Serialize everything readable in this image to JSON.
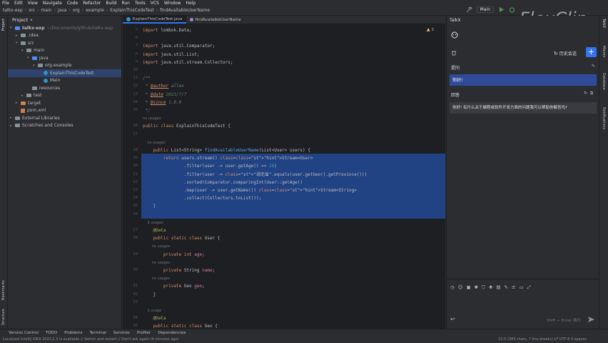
{
  "menu": [
    "File",
    "Edit",
    "View",
    "Navigate",
    "Code",
    "Refactor",
    "Build",
    "Run",
    "Tools",
    "VCS",
    "Window",
    "Help"
  ],
  "breadcrumbs": [
    "talkx-exp",
    "src",
    "main",
    "java",
    "org",
    "example",
    "ExplainThisCodeTest",
    "findAvailableUserName"
  ],
  "run_config": "Main",
  "watermark": "FlexClip",
  "project_panel": {
    "title": "Project",
    "tree": [
      {
        "label": "talkx-exp",
        "extra": "~/Documents/github/talkx-exp",
        "type": "folder-blue",
        "depth": 0,
        "arrow": "▾"
      },
      {
        "label": ".idea",
        "type": "folder",
        "depth": 1,
        "arrow": "▸"
      },
      {
        "label": "src",
        "type": "folder",
        "depth": 1,
        "arrow": "▾"
      },
      {
        "label": "main",
        "type": "folder",
        "depth": 2,
        "arrow": "▾"
      },
      {
        "label": "java",
        "type": "folder-blue",
        "depth": 3,
        "arrow": "▾"
      },
      {
        "label": "org.example",
        "type": "folder",
        "depth": 4,
        "arrow": "▾"
      },
      {
        "label": "ExplainThisCodeTest",
        "type": "java",
        "depth": 5,
        "arrow": "",
        "selected": true
      },
      {
        "label": "Main",
        "type": "java",
        "depth": 5,
        "arrow": ""
      },
      {
        "label": "resources",
        "type": "folder",
        "depth": 3,
        "arrow": ""
      },
      {
        "label": "test",
        "type": "folder",
        "depth": 2,
        "arrow": "▸"
      },
      {
        "label": "target",
        "type": "folder-orange",
        "depth": 1,
        "arrow": "▸"
      },
      {
        "label": "pom.xml",
        "type": "xml",
        "depth": 1,
        "arrow": ""
      },
      {
        "label": "External Libraries",
        "type": "folder",
        "depth": 0,
        "arrow": "▸"
      },
      {
        "label": "Scratches and Consoles",
        "type": "folder",
        "depth": 0,
        "arrow": "▸"
      }
    ]
  },
  "editor": {
    "tabs": [
      "ExplainThisCodeTest.java",
      "findAvailableUserName"
    ],
    "warning_count": "3",
    "line_numbers": [
      "5",
      "6",
      "7",
      "8",
      "9",
      "10",
      "11",
      "12",
      "13",
      "14",
      "15",
      "16",
      "17",
      "18",
      "19",
      "20",
      "21",
      "22",
      "23",
      "24",
      "25",
      "26",
      "27",
      "28",
      "29",
      "30",
      "31",
      "32",
      "33",
      "34",
      "35",
      "36",
      "37"
    ],
    "code": [
      "import lombok.Data;",
      "",
      "import java.util.Comparator;",
      "import java.util.List;",
      "import java.util.stream.Collectors;",
      "",
      "/**",
      " * @author allen",
      " * @date 2023/7/7",
      " * @since 1.0.0",
      " */",
      "no usages",
      "public class ExplainThisCodeTest {",
      "",
      "    no usages",
      "    public List<String> findAvailableUserName(List<User> users) {",
      "        return users.stream() Stream<User>",
      "                .filter(user -> user.getAge() >= 18)",
      "                .filter(user -> \"湖北省\".equals(user.getGeo().getProvince()))",
      "                .sorted(Comparator.comparingInt(User::getAge))",
      "                .map(user -> user.getName()) Stream<String>",
      "                .collect(Collectors.toList());",
      "    }",
      "",
      "    3 usages",
      "    @Data",
      "    public static class User {",
      "        no usages",
      "        private int age;",
      "        no usages",
      "        private String name;",
      "        no usages",
      "        private Geo geo;",
      "    }",
      "",
      "    1 usage",
      "    @Data",
      "    public static class Geo {"
    ]
  },
  "talkx": {
    "title": "TalkX",
    "history_label": "历史会话",
    "question_label": "提问",
    "question_text": "你好!",
    "answer_label": "回答",
    "answer_text": "你好! 有什么关于编程或软件开发方面的问题我可以帮助你解答吗?",
    "input_placeholder": "Shift + Enter 换行"
  },
  "bottom_tools": [
    "Version Control",
    "TODO",
    "Problems",
    "Terminal",
    "Services",
    "Profiler",
    "Dependencies"
  ],
  "status_left": "Localized IntelliJ IDEA 2023.2.3 is available // Switch and restart // Don't ask again (4 minutes ago)",
  "status_right": "15:5 (383 chars, 7 line breaks)   LF   UTF-8   4 spaces",
  "left_strip": [
    "Project",
    "Bookmarks",
    "Structure"
  ],
  "right_strip": [
    "TalkX",
    "Maven",
    "Database",
    "Notifications"
  ]
}
